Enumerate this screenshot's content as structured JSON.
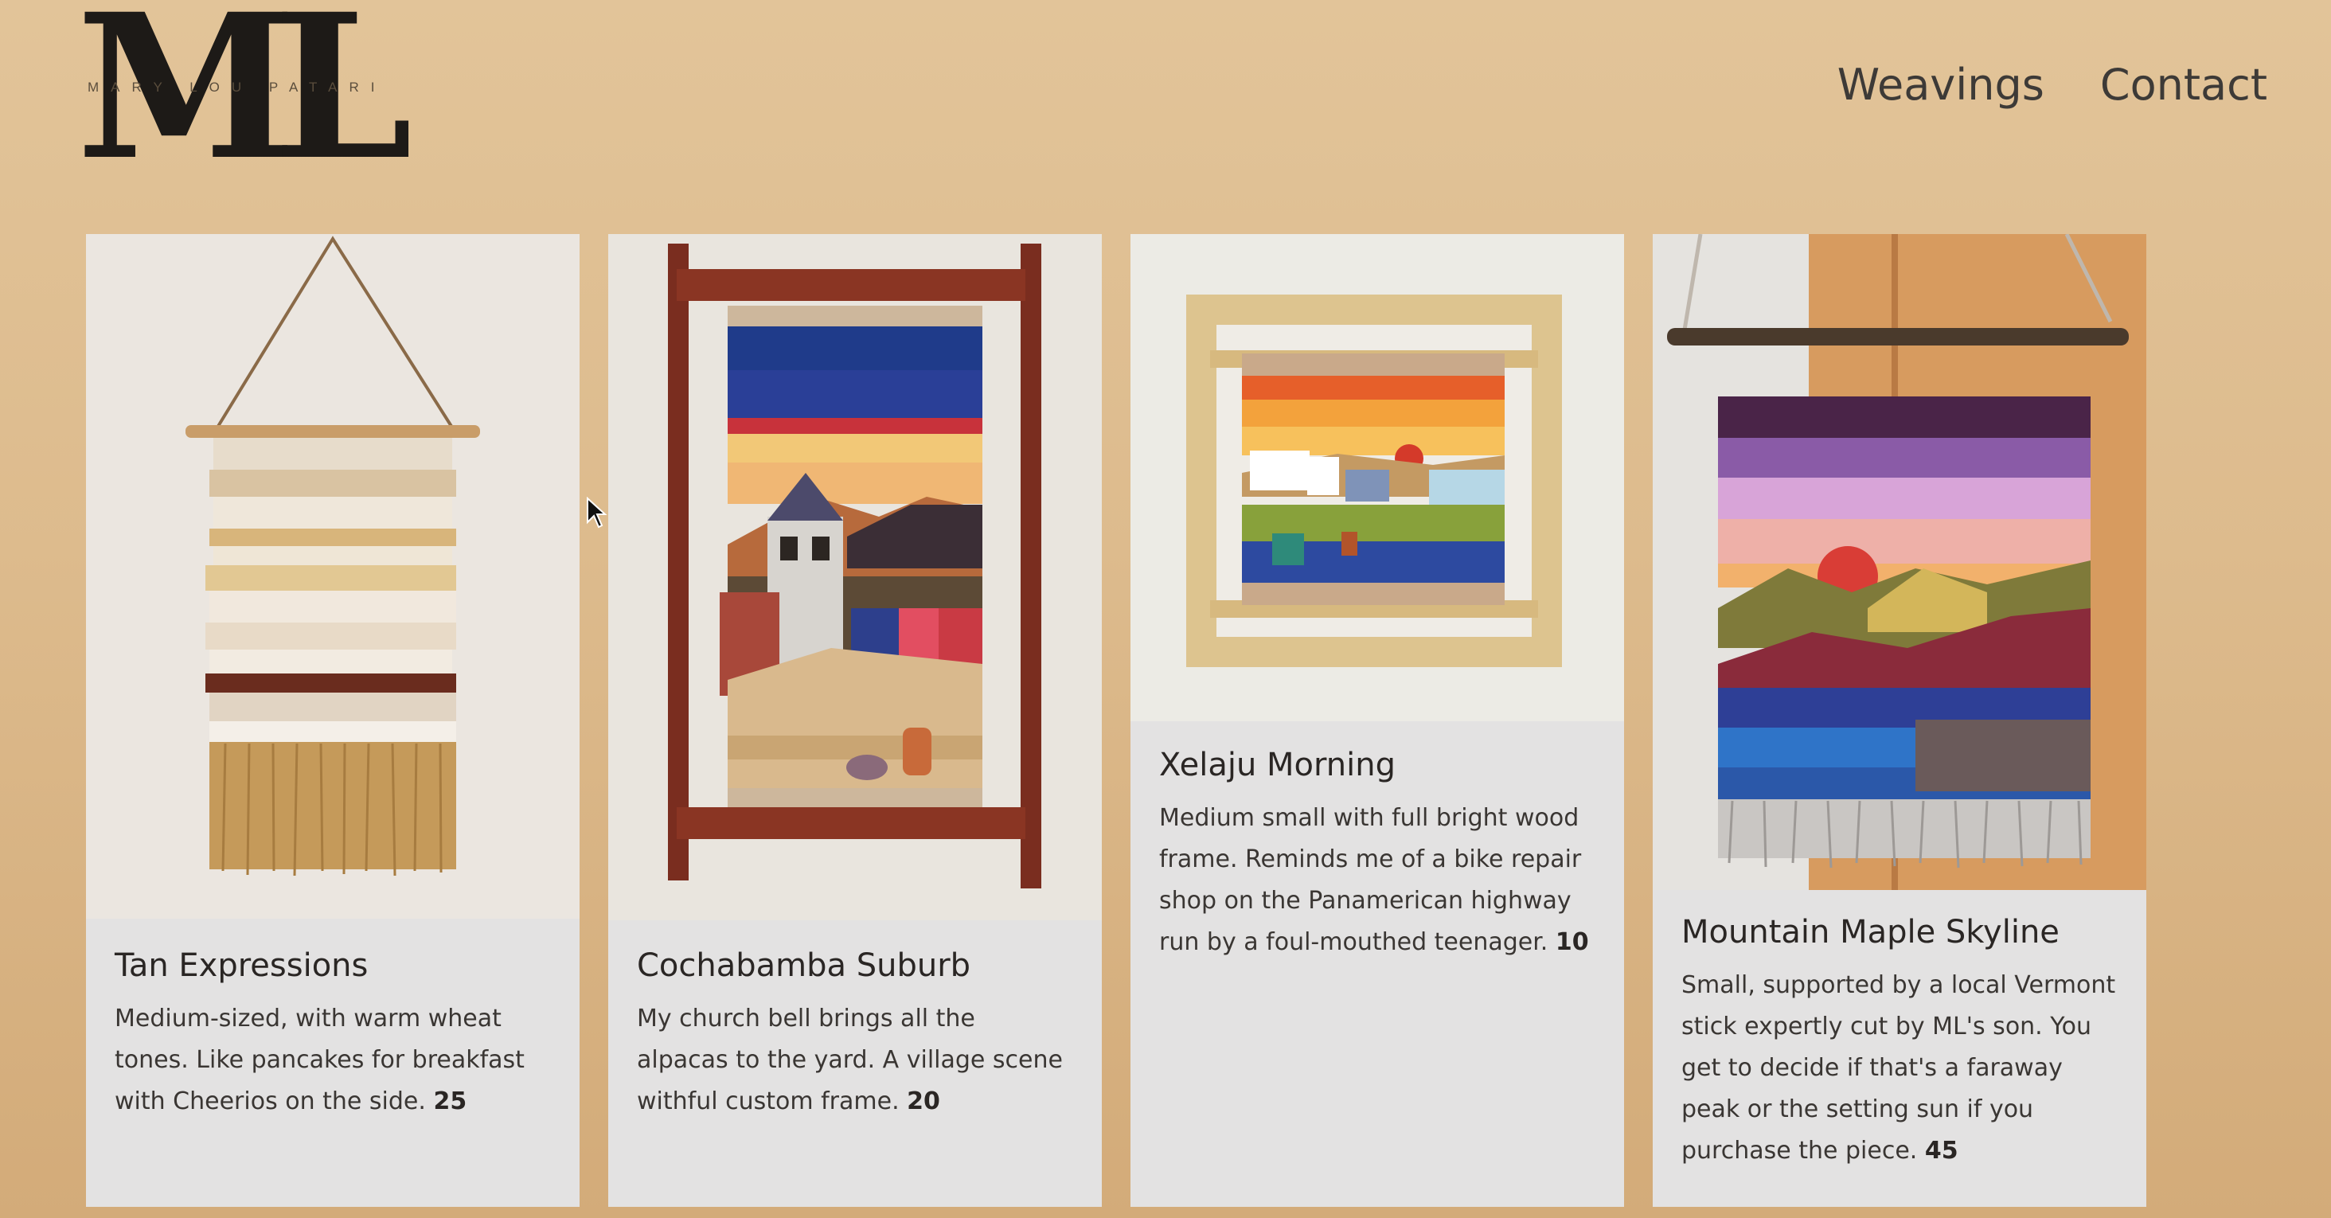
{
  "brand": {
    "monogram": "ML",
    "name": "MARY LOU PATARI"
  },
  "nav": {
    "items": [
      {
        "label": "Weavings"
      },
      {
        "label": "Contact"
      }
    ]
  },
  "cards": [
    {
      "title": "Tan Expressions",
      "description": "Medium-sized, with warm wheat tones. Like pancakes for breakfast with Cheerios on the side.",
      "price": "25"
    },
    {
      "title": "Cochabamba Suburb",
      "description": "My church bell brings all the alpacas to the yard. A village scene withful custom frame.",
      "price": "20"
    },
    {
      "title": "Xelaju Morning",
      "description": "Medium small with full bright wood frame. Reminds me of a bike repair shop on the Panamerican highway run by a foul-mouthed teenager.",
      "price": "10"
    },
    {
      "title": "Mountain Maple Skyline",
      "description": "Small, supported by a local Vermont stick expertly cut by ML's son. You get to decide if that's a faraway peak or the setting sun if you purchase the piece.",
      "price": "45"
    }
  ]
}
